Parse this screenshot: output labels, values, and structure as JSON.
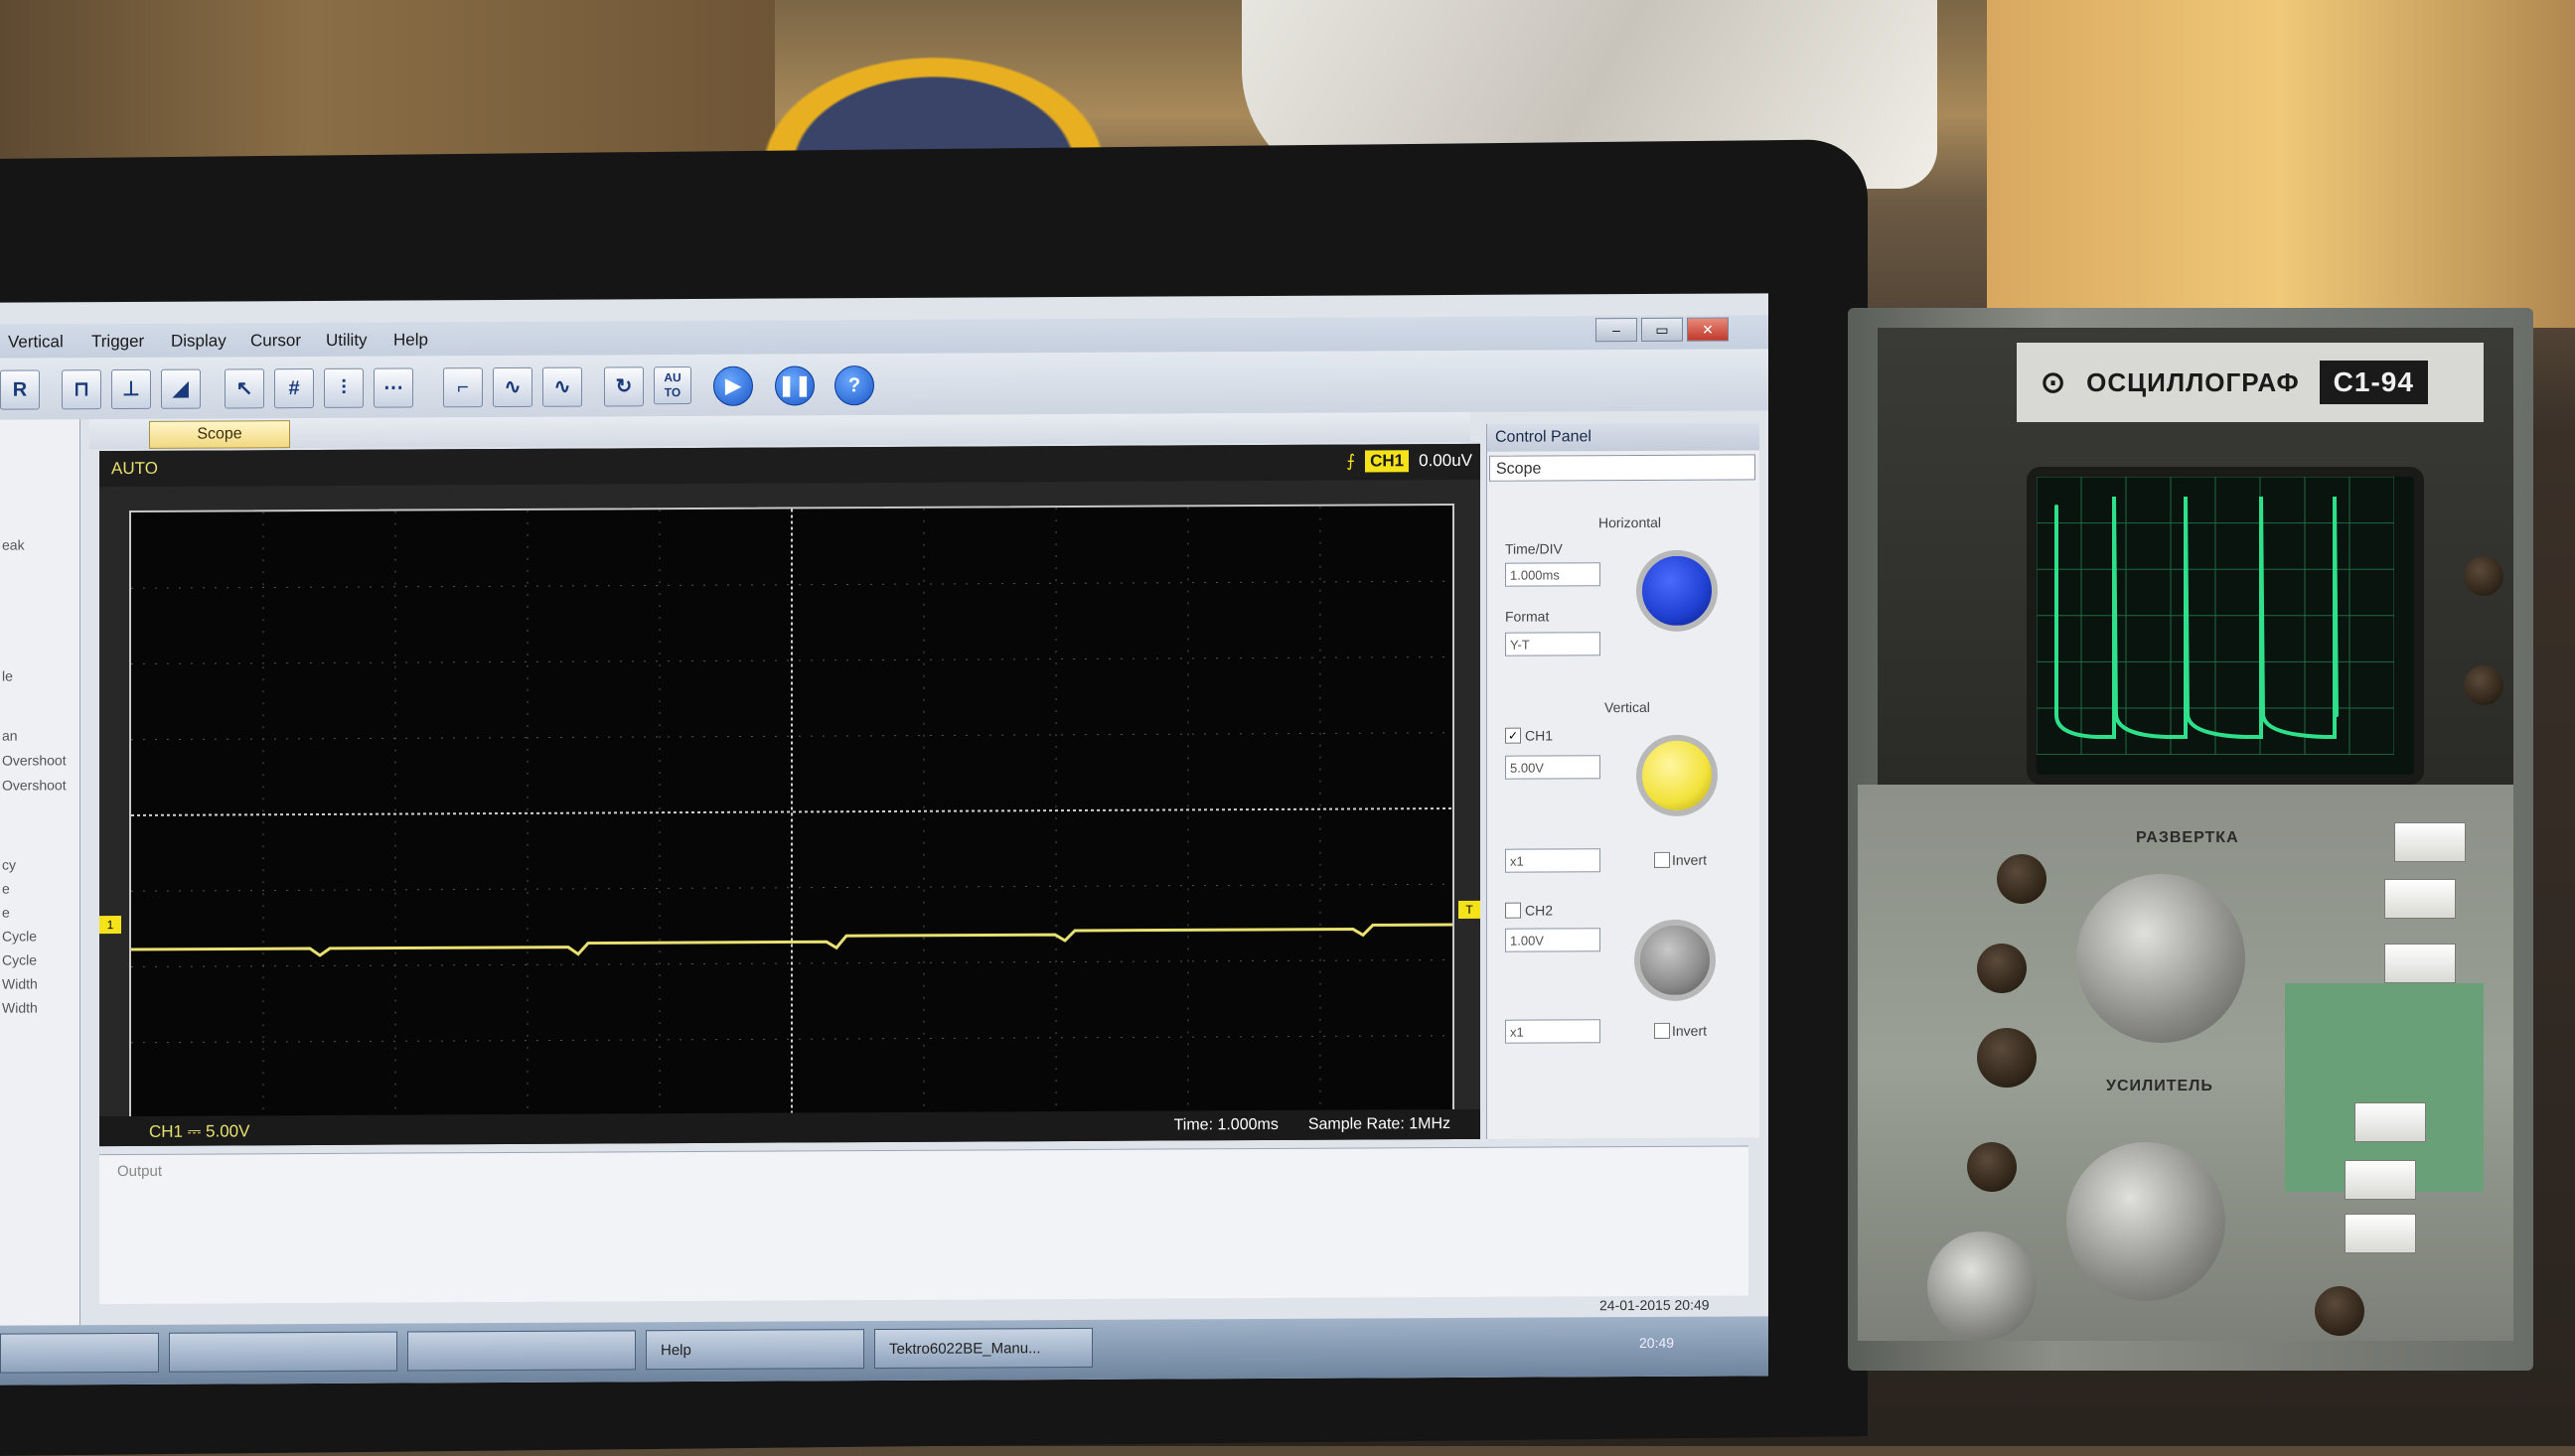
{
  "menu": [
    "Vertical",
    "Trigger",
    "Display",
    "Cursor",
    "Utility",
    "Help"
  ],
  "toolbar": {
    "auto_label": "AU TO",
    "help_label": "?"
  },
  "left_panel": [
    "eak",
    "le",
    "an",
    "Overshoot",
    "Overshoot",
    "cy",
    "e",
    "e",
    "Cycle",
    "Cycle",
    "Width",
    "Width"
  ],
  "scope": {
    "tab_label": "Scope",
    "mode": "AUTO",
    "trigger_channel": "CH1",
    "trigger_level": "0.00uV",
    "ch1_scale": "CH1 ⎓ 5.00V",
    "time_label": "Time: 1.000ms",
    "sample_rate": "Sample Rate: 1MHz",
    "trace_color": "#e8e070"
  },
  "control_panel": {
    "title": "Control Panel",
    "mode_select": "Scope",
    "horizontal_label": "Horizontal",
    "timediv_label": "Time/DIV",
    "timediv_value": "1.000ms",
    "format_label": "Format",
    "format_value": "Y-T",
    "vertical_label": "Vertical",
    "ch1_label": "CH1",
    "ch1_volts": "5.00V",
    "ch1_probe": "x1",
    "ch1_invert": "Invert",
    "ch2_label": "CH2",
    "ch2_volts": "1.00V",
    "ch2_probe": "x1",
    "ch2_invert": "Invert",
    "colors": {
      "horizontal_knob": "#1e3fd0",
      "ch1_knob": "#f2e23a",
      "ch2_knob": "#8a8a8a"
    }
  },
  "output": {
    "label": "Output"
  },
  "status": {
    "datetime": "24-01-2015 20:49",
    "clock": "20:49"
  },
  "taskbar": [
    "Help",
    "Tektro6022BE_Manu..."
  ],
  "oscilloscope": {
    "brand": "ОСЦИЛЛОГРАФ",
    "model": "С1-94",
    "sweep_label": "РАЗВЕРТКА",
    "amp_label": "УСИЛИТЕЛЬ",
    "screen_color": "#2ee08a"
  }
}
